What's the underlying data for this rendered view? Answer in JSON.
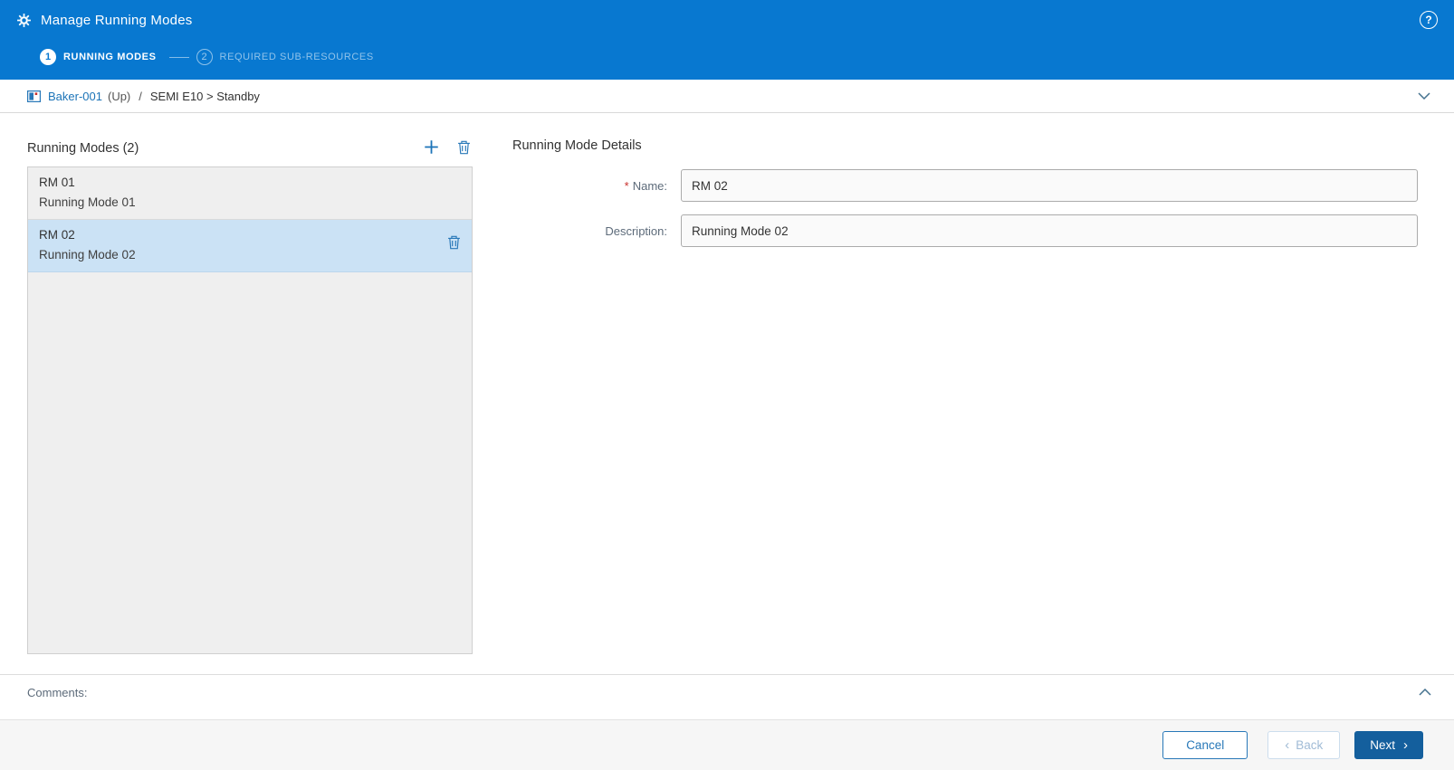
{
  "header": {
    "title": "Manage Running Modes",
    "help_glyph": "?"
  },
  "wizard": {
    "steps": [
      {
        "number": "1",
        "label": "RUNNING MODES",
        "active": true
      },
      {
        "number": "2",
        "label": "REQUIRED SUB-RESOURCES",
        "active": false
      }
    ]
  },
  "breadcrumb": {
    "resource": "Baker-001",
    "state": "(Up)",
    "separator": "/",
    "path": "SEMI E10 > Standby"
  },
  "running_modes": {
    "title": "Running Modes (2)",
    "items": [
      {
        "name": "RM 01",
        "description": "Running Mode 01",
        "selected": false
      },
      {
        "name": "RM 02",
        "description": "Running Mode 02",
        "selected": true
      }
    ]
  },
  "details": {
    "title": "Running Mode Details",
    "required_marker": "*",
    "name_label": "Name:",
    "name_value": "RM 02",
    "description_label": "Description:",
    "description_value": "Running Mode 02"
  },
  "comments": {
    "label": "Comments:"
  },
  "footer": {
    "cancel_label": "Cancel",
    "back_label": "Back",
    "next_label": "Next",
    "back_chevron": "‹",
    "next_chevron": "›"
  },
  "colors": {
    "header_blue": "#0878d0",
    "link_blue": "#1c74b8",
    "primary_button": "#145f9d",
    "selected_item": "#cbe2f5",
    "required_red": "#c9302c"
  }
}
